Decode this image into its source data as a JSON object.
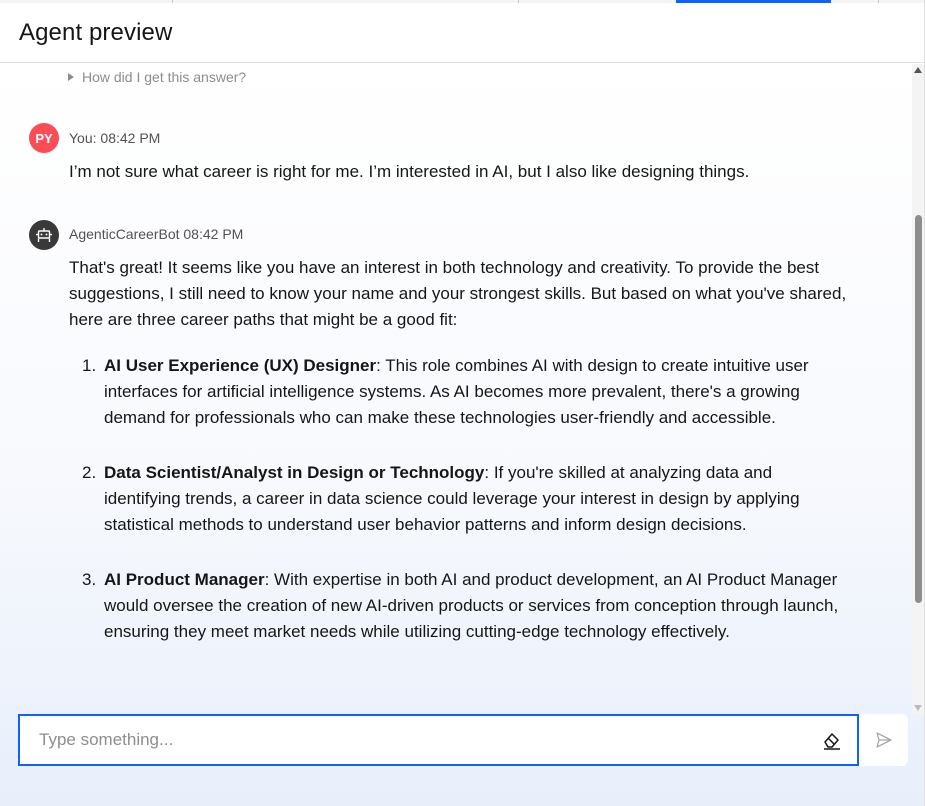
{
  "header": {
    "title": "Agent preview"
  },
  "chat": {
    "how_label": "How did I get this answer?",
    "user": {
      "initials": "PY",
      "meta": "You: 08:42 PM",
      "text": "I’m not sure what career is right for me. I’m interested in AI, but I also like designing things."
    },
    "bot": {
      "meta": "AgenticCareerBot 08:42 PM",
      "intro": "That's great! It seems like you have an interest in both technology and creativity. To provide the best suggestions, I still need to know your name and your strongest skills. But based on what you've shared, here are three career paths that might be a good fit:",
      "items": [
        {
          "num": "1.",
          "title": "AI User Experience (UX) Designer",
          "text": ": This role combines AI with design to create intuitive user interfaces for artificial intelligence systems. As AI becomes more prevalent, there's a growing demand for professionals who can make these technologies user-friendly and accessible."
        },
        {
          "num": "2.",
          "title": "Data Scientist/Analyst in Design or Technology",
          "text": ": If you're skilled at analyzing data and identifying trends, a career in data science could leverage your interest in design by applying statistical methods to understand user behavior patterns and inform design decisions."
        },
        {
          "num": "3.",
          "title": "AI Product Manager",
          "text": ": With expertise in both AI and product development, an AI Product Manager would oversee the creation of new AI-driven products or services from conception through launch, ensuring they meet market needs while utilizing cutting-edge technology effectively."
        }
      ]
    }
  },
  "composer": {
    "placeholder": "Type something..."
  },
  "icons": {
    "user_avatar": "user-avatar",
    "bot_avatar": "robot-icon",
    "erase": "eraser-icon",
    "send": "send-icon",
    "expand": "triangle-right-icon"
  },
  "colors": {
    "accent": "#0f62fe",
    "user_avatar": "#fa4d56",
    "bot_avatar": "#393939"
  }
}
